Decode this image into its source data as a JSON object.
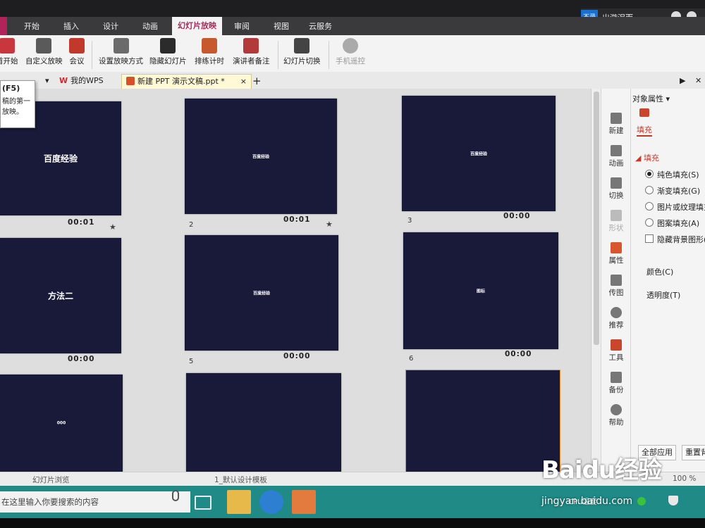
{
  "ribbon_tabs": [
    "开始",
    "插入",
    "设计",
    "动画",
    "幻灯片放映",
    "审阅",
    "视图",
    "云服务"
  ],
  "active_tab": "幻灯片放映",
  "account": {
    "badge": "不录",
    "name": "出游泥而..."
  },
  "toolbar": {
    "from_start": "首开始",
    "custom_show": "自定义放映",
    "meeting": "会议",
    "setup_show": "设置放映方式",
    "hide_slide": "隐藏幻灯片",
    "rehearse": "排练计时",
    "presenter_notes": "演讲者备注",
    "transition": "幻灯片切换",
    "phone_remote": "手机遥控"
  },
  "tooltip": {
    "key": "(F5)",
    "line1": "稿的第一",
    "line2": "放映。"
  },
  "doc_tabs": {
    "mywps": "我的WPS",
    "current": "新建 PPT 演示文稿.ppt *"
  },
  "slides": [
    {
      "title": "百度经验",
      "timing": "00:01",
      "number": "",
      "star": true
    },
    {
      "title": "百度经验",
      "timing": "00:01",
      "number": "2",
      "star": true
    },
    {
      "title": "百度经验",
      "timing": "00:00",
      "number": "3",
      "star": false
    },
    {
      "title": "方法二",
      "timing": "00:00",
      "number": "",
      "star": false
    },
    {
      "title": "百度经验",
      "timing": "00:00",
      "number": "5",
      "star": false
    },
    {
      "title": "图标",
      "timing": "00:00",
      "number": "6",
      "star": false
    },
    {
      "title": "000",
      "timing": "",
      "number": "",
      "star": false
    },
    {
      "title": "",
      "timing": "",
      "number": "",
      "star": false
    },
    {
      "title": "",
      "timing": "",
      "number": "",
      "star": false
    }
  ],
  "side_strip": [
    "新建",
    "动画",
    "切换",
    "形状",
    "属性",
    "传图",
    "推荐",
    "工具",
    "备份",
    "帮助"
  ],
  "props": {
    "header": "对象属性",
    "fill_tab": "填充",
    "fill_section": "填充",
    "opt_solid": "纯色填充(S)",
    "opt_gradient": "渐变填充(G)",
    "opt_picture": "图片或纹理填充",
    "opt_pattern": "图案填充(A)",
    "opt_hide": "隐藏背景图形(",
    "color": "颜色(C)",
    "transparency": "透明度(T)",
    "apply_all": "全部应用",
    "reset": "重置背"
  },
  "status": {
    "view": "幻灯片浏览",
    "template": "1_默认设计模板",
    "zoom": "100 %"
  },
  "taskbar": {
    "search": "在这里输入你要搜索的内容",
    "tray_label": "CPU温度"
  },
  "watermark": {
    "logo": "Baidu经验",
    "url": "jingyan.baidu.com"
  },
  "colors": {
    "accent": "#b0245a",
    "slide_bg": "#191a3a",
    "taskbar": "#1f8a86"
  }
}
